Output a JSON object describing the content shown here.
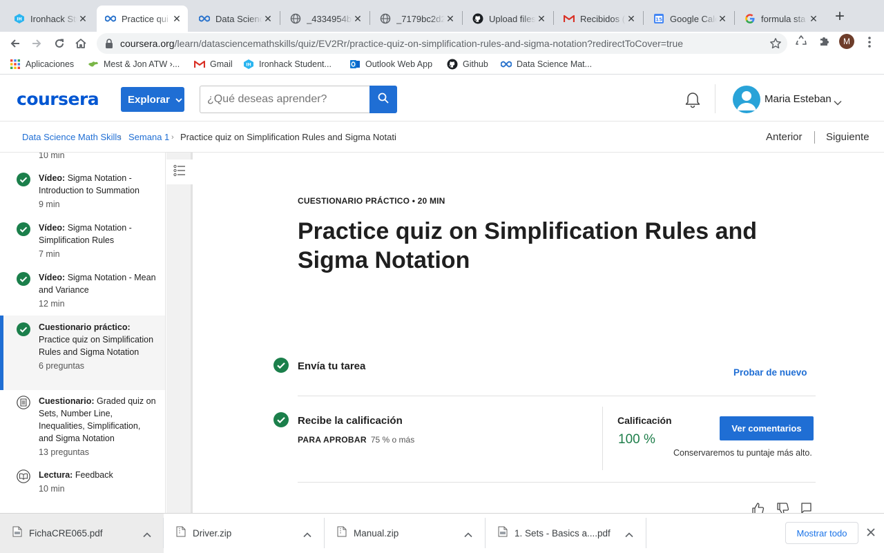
{
  "browser": {
    "tabs": [
      {
        "title": "Ironhack Stu",
        "icon": "ironhack-icon"
      },
      {
        "title": "Practice qui",
        "icon": "coursera-infinity-icon"
      },
      {
        "title": "Data Scienc",
        "icon": "coursera-infinity-icon"
      },
      {
        "title": "_4334954b",
        "icon": "globe-icon"
      },
      {
        "title": "_7179bc2d2",
        "icon": "globe-icon"
      },
      {
        "title": "Upload files",
        "icon": "github-icon"
      },
      {
        "title": "Recibidos (",
        "icon": "gmail-icon"
      },
      {
        "title": "Google Cale",
        "icon": "google-calendar-icon"
      },
      {
        "title": "formula sta",
        "icon": "google-icon"
      }
    ],
    "calendar_day": "15",
    "url_host": "coursera.org",
    "url_path": "/learn/datasciencemathskills/quiz/EV2Rr/practice-quiz-on-simplification-rules-and-sigma-notation?redirectToCover=true",
    "profile_initial": "M",
    "bookmarks": [
      {
        "label": "Aplicaciones",
        "icon": "apps-grid-icon"
      },
      {
        "label": "Mest & Jon ATW ›...",
        "icon": "map-icon"
      },
      {
        "label": "Gmail",
        "icon": "gmail-icon"
      },
      {
        "label": "Ironhack Student...",
        "icon": "ironhack-icon"
      },
      {
        "label": "Outlook Web App",
        "icon": "outlook-icon"
      },
      {
        "label": "Github",
        "icon": "github-icon"
      },
      {
        "label": "Data Science Mat...",
        "icon": "coursera-infinity-icon"
      }
    ]
  },
  "header": {
    "logo": "coursera",
    "explore_label": "Explorar",
    "search_placeholder": "¿Qué deseas aprender?",
    "user_name": "Maria Esteban"
  },
  "breadcrumb": {
    "items": [
      "Data Science Math Skills",
      "Semana 1",
      "Practice quiz on Simplification Rules and Sigma Notati"
    ],
    "prev": "Anterior",
    "next": "Siguiente"
  },
  "sidebar": {
    "cut_meta": "10 min",
    "items": [
      {
        "type": "Vídeo:",
        "name": "Sigma Notation - Introduction to Summation",
        "meta": "9 min",
        "status": "done"
      },
      {
        "type": "Vídeo:",
        "name": "Sigma Notation - Simplification Rules",
        "meta": "7 min",
        "status": "done"
      },
      {
        "type": "Vídeo:",
        "name": "Sigma Notation - Mean and Variance",
        "meta": "12 min",
        "status": "done"
      },
      {
        "type": "Cuestionario práctico:",
        "name": "Practice quiz on Simplification Rules and Sigma Notation",
        "meta": "6 preguntas",
        "status": "done"
      },
      {
        "type": "Cuestionario:",
        "name": "Graded quiz on Sets, Number Line, Inequalities, Simplification, and Sigma Notation",
        "meta": "13 preguntas",
        "status": "quiz"
      },
      {
        "type": "Lectura:",
        "name": "Feedback",
        "meta": "10 min",
        "status": "reading"
      }
    ]
  },
  "main": {
    "eyebrow": "CUESTIONARIO PRÁCTICO • 20 MIN",
    "title": "Practice quiz on Simplification Rules and Sigma Notation",
    "step1_label": "Envía tu tarea",
    "retry_label": "Probar de nuevo",
    "step2_label": "Recibe la calificación",
    "pass_label": "PARA APROBAR",
    "pass_value": "75 % o más",
    "grade_label": "Calificación",
    "grade_value": "100 %",
    "view_feedback_label": "Ver comentarios",
    "keep_note": "Conservaremos tu puntaje más alto."
  },
  "downloads": {
    "files": [
      "FichaCRE065.pdf",
      "Driver.zip",
      "Manual.zip",
      "1. Sets - Basics a....pdf"
    ],
    "show_all_label": "Mostrar todo"
  },
  "colors": {
    "brand_blue": "#0056d2",
    "button_blue": "#1f6ed4",
    "success_green": "#1e7e4a",
    "check_green": "#1b7f4b"
  }
}
